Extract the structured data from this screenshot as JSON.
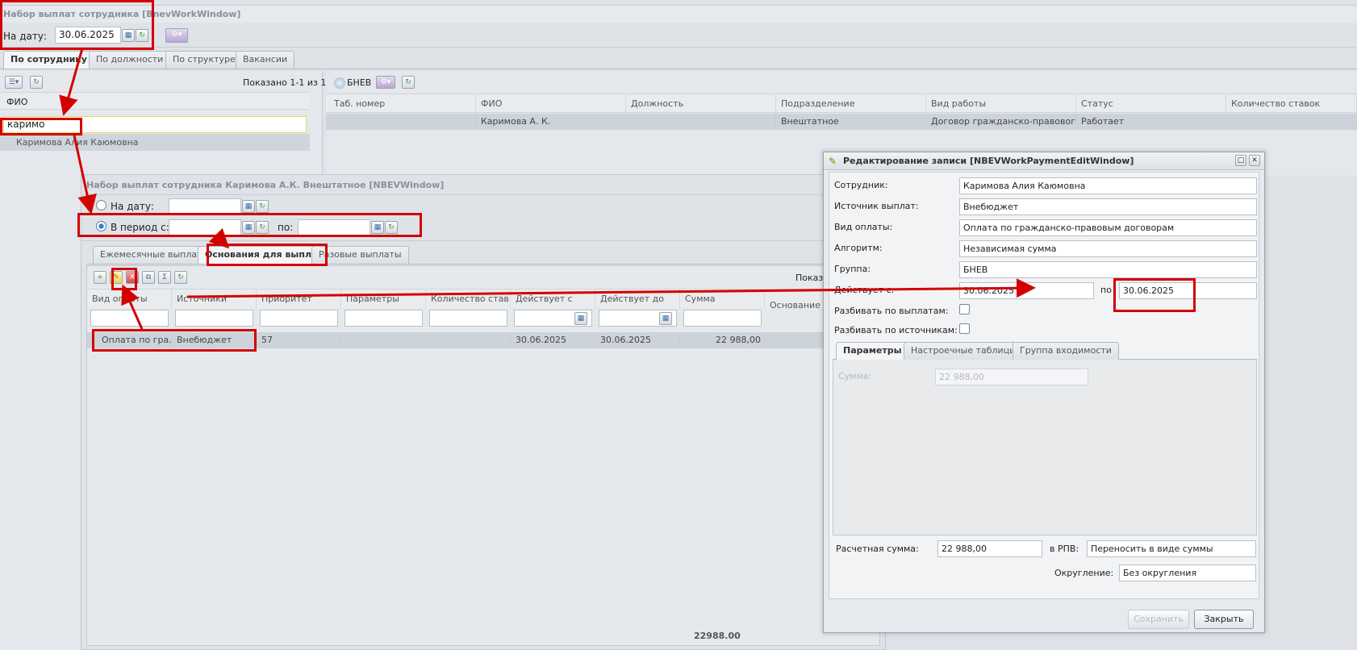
{
  "main_window": {
    "title": "Набор выплат сотрудника [BnevWorkWindow]",
    "date_label": "На дату:",
    "date_value": "30.06.2025",
    "tabs": [
      "По сотруднику",
      "По должности",
      "По структуре",
      "Вакансии"
    ]
  },
  "left_panel": {
    "shown_count": "Показано 1-1 из 1",
    "column_header": "ФИО",
    "filter_value": "каримо",
    "result": "Каримова Алия Каюмовна"
  },
  "right_panel": {
    "toolbar_label": "БНЕВ",
    "columns": [
      "Таб. номер",
      "ФИО",
      "Должность",
      "Подразделение",
      "Вид работы",
      "Статус",
      "Количество ставок"
    ],
    "row": [
      "",
      "Каримова А. К.",
      "",
      "Внештатное",
      "Договор гражданско-правового ...",
      "Работает",
      ""
    ]
  },
  "nbev_window": {
    "title": "Набор выплат сотрудника Каримова А.К. Внештатное [NBEVWindow]",
    "on_date_label": "На дату:",
    "period_label": "В период с:",
    "period_to_label": "по:",
    "tabs": [
      "Ежемесячные выплаты",
      "Основания для выплат",
      "Разовые выплаты"
    ],
    "shown_label": "Показа",
    "columns": [
      "Вид оплаты",
      "Источники",
      "Приоритет",
      "Параметры",
      "Количество став...",
      "Действует с",
      "Действует до",
      "Сумма",
      "Основание"
    ],
    "row": [
      "Оплата по гра...",
      "Внебюджет",
      "57",
      "",
      "",
      "30.06.2025",
      "30.06.2025",
      "22 988,00"
    ],
    "footer_total": "22988.00"
  },
  "edit_window": {
    "title": "Редактирование записи [NBEVWorkPaymentEditWindow]",
    "fields": [
      {
        "label": "Сотрудник:",
        "value": "Каримова Алия Каюмовна"
      },
      {
        "label": "Источник выплат:",
        "value": "Внебюджет"
      },
      {
        "label": "Вид оплаты:",
        "value": "Оплата по гражданско-правовым договорам"
      },
      {
        "label": "Алгоритм:",
        "value": "Независимая сумма"
      },
      {
        "label": "Группа:",
        "value": "БНЕВ"
      }
    ],
    "active_from_label": "Действует с:",
    "active_from_value": "30.06.2025",
    "active_to_label": "по",
    "active_to_value": "30.06.2025",
    "split_payments_label": "Разбивать по выплатам:",
    "split_sources_label": "Разбивать по источникам:",
    "tabs": [
      "Параметры",
      "Настроечные таблицы",
      "Группа входимости"
    ],
    "sum_label": "Сумма:",
    "sum_value": "22 988,00",
    "calc_sum_label": "Расчетная сумма:",
    "calc_sum_value": "22 988,00",
    "rpv_label": "в РПВ:",
    "rpv_value": "Переносить в виде суммы",
    "rounding_label": "Округление:",
    "rounding_value": "Без округления",
    "save_button": "Сохранить",
    "close_button": "Закрыть"
  },
  "colors": {
    "annotation": "#d40000",
    "grid_row": "#cdd3da",
    "window_bg": "#dfe3e8"
  }
}
